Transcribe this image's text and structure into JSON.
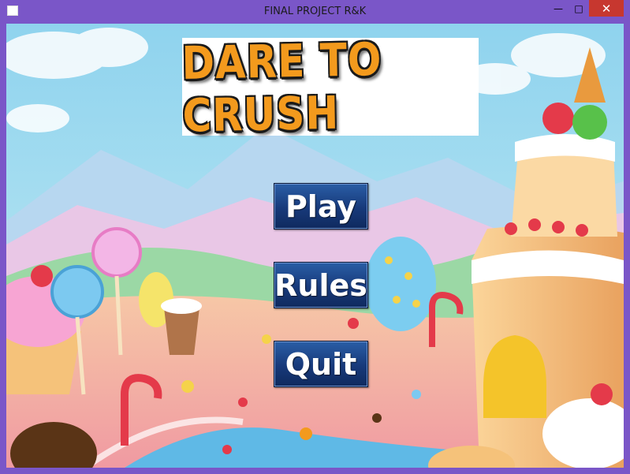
{
  "window": {
    "title": "FINAL PROJECT R&K",
    "min_icon": "minimize-icon",
    "max_icon": "maximize-icon",
    "close_icon": "close-icon"
  },
  "logo": {
    "text": "DARE TO CRUSH"
  },
  "menu": {
    "play_label": "Play",
    "rules_label": "Rules",
    "quit_label": "Quit"
  },
  "colors": {
    "frame": "#7a56c8",
    "button": "#1f4a8e",
    "logo_fill": "#f39a1d",
    "sky": "#9fd9ef"
  }
}
